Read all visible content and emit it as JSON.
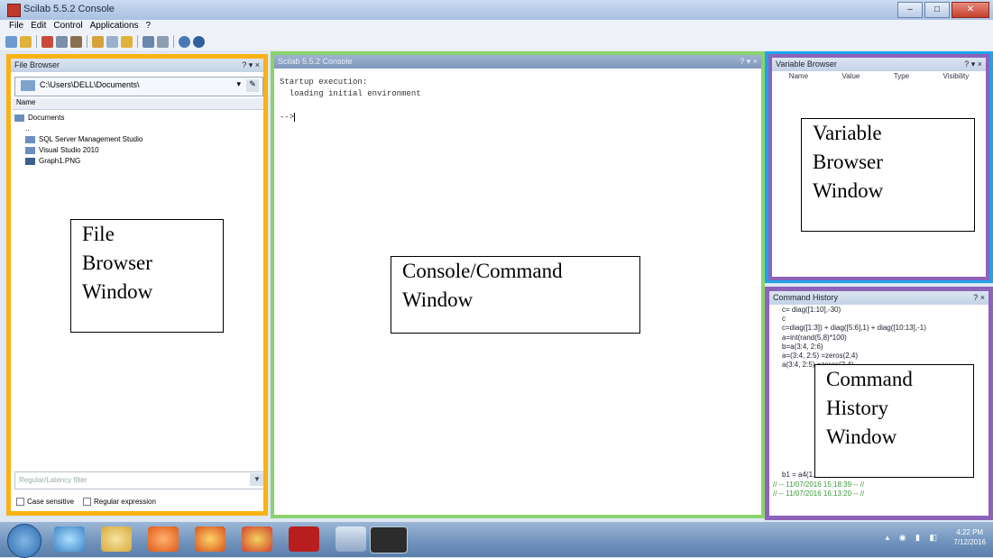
{
  "window": {
    "title": "Scilab 5.5.2 Console",
    "controls": [
      "–",
      "□",
      "✕"
    ]
  },
  "menu": [
    "File",
    "Edit",
    "Control",
    "Applications",
    "?"
  ],
  "file_browser": {
    "title": "File Browser",
    "ctrls": "? ▾ ×",
    "path": "C:\\Users\\DELL\\Documents\\",
    "column": "Name",
    "tree": [
      "Documents",
      "..",
      "SQL Server Management Studio",
      "Visual Studio 2010",
      "Graph1.PNG"
    ],
    "filter_placeholder": "Regular/Latency filter",
    "check_case": "Case sensitive",
    "check_regex": "Regular expression",
    "label": [
      "File",
      "Browser",
      "Window"
    ]
  },
  "console": {
    "title": "Scilab 5.5.2 Console",
    "ctrls": "? ▾ ×",
    "lines": [
      "Startup execution:",
      "  loading initial environment",
      "",
      "-->"
    ],
    "label": [
      "Console/Command",
      "Window"
    ]
  },
  "variable_browser": {
    "title": "Variable Browser",
    "ctrls": "? ▾ ×",
    "columns": [
      "Name",
      "Value",
      "Type",
      "Visibility"
    ],
    "label": [
      "Variable",
      "Browser",
      "Window"
    ]
  },
  "command_history": {
    "title": "Command History",
    "ctrls": "? ×",
    "entries": [
      "c= diag([1:10],-30)",
      "c",
      "c=diag([1:3]) + diag([5:6],1) + diag([10:13],-1)",
      "a=int(rand(5,8)*100)",
      "b=a(3:4, 2:6)",
      "a=(3:4, 2:5) =zeros(2,4)",
      "a(3:4, 2:5) =zeros(2,4)",
      "",
      "",
      "",
      "",
      "",
      "",
      "",
      "",
      "",
      "",
      "",
      "b1 = a4(1,2), 9)"
    ],
    "sessions": [
      "// -- 11/07/2016 15:18:39 -- //",
      "// -- 11/07/2016 16:13:20 -- //"
    ],
    "label": [
      "Command",
      "History",
      "Window"
    ]
  },
  "taskbar": {
    "time": "4:22 PM",
    "date": "7/12/2016"
  }
}
